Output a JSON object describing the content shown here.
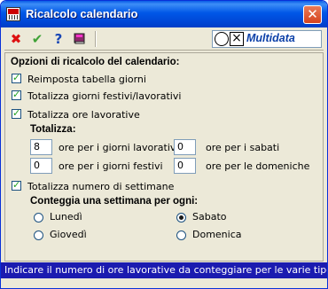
{
  "window": {
    "title": "Ricalcolo calendario",
    "close_label": "✕"
  },
  "toolbar": {
    "cancel_icon": "close-icon",
    "confirm_icon": "checkmark-icon",
    "help_icon": "question-icon",
    "book_icon": "book-icon",
    "brand": "Multidata"
  },
  "options": {
    "heading": "Opzioni di ricalcolo del calendario:",
    "reset_table": {
      "label": "Reimposta tabella giorni",
      "checked": true
    },
    "total_days": {
      "label": "Totalizza giorni festivi/lavorativi",
      "checked": true
    },
    "total_hours": {
      "label": "Totalizza ore lavorative",
      "checked": true
    },
    "totals_heading": "Totalizza:",
    "hours": {
      "workdays": {
        "value": "8",
        "label": "ore per i giorni lavorativi"
      },
      "saturdays": {
        "value": "0",
        "label": "ore per i sabati"
      },
      "holidays": {
        "value": "0",
        "label": "ore per i giorni festivi"
      },
      "sundays": {
        "value": "0",
        "label": "ore per le domeniche"
      }
    },
    "total_weeks": {
      "label": "Totalizza numero di settimane",
      "checked": true
    },
    "week_heading": "Conteggia una settimana per ogni:",
    "week_days": [
      {
        "label": "Lunedì",
        "selected": false
      },
      {
        "label": "Sabato",
        "selected": true
      },
      {
        "label": "Giovedì",
        "selected": false
      },
      {
        "label": "Domenica",
        "selected": false
      }
    ]
  },
  "status": "Indicare il numero di ore lavorative da conteggiare per le varie tipologie di"
}
